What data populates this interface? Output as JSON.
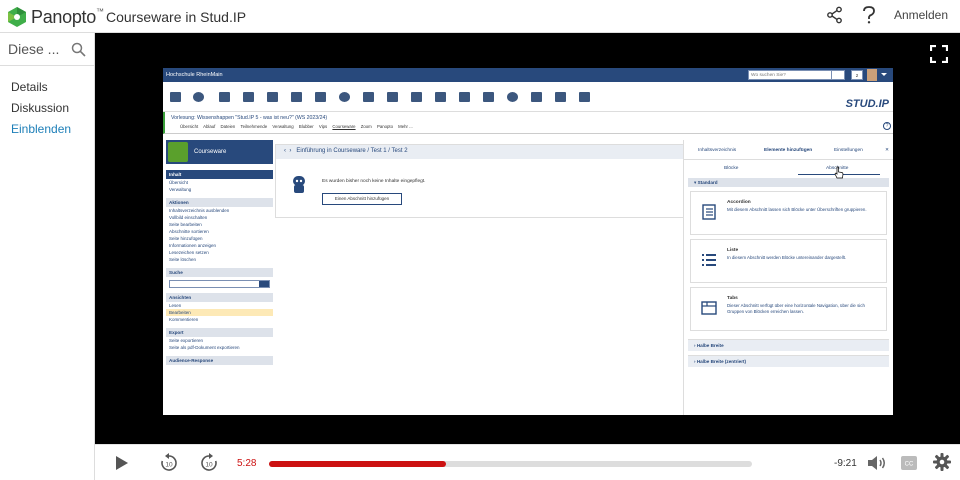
{
  "header": {
    "brand": "Panopto",
    "title": "Courseware in Stud.IP",
    "login": "Anmelden"
  },
  "sidebar": {
    "search_label": "Diese ...",
    "items": [
      {
        "label": "Details"
      },
      {
        "label": "Diskussion"
      },
      {
        "label": "Einblenden"
      }
    ]
  },
  "controls": {
    "elapsed": "5:28",
    "remaining": "-9:21",
    "progress_fraction": 0.367,
    "progress_color": "#cc1111"
  },
  "screen": {
    "org": "Hochschule RheinMain",
    "search_placeholder": "Wo suchen Sie?",
    "count": "2",
    "vlabel": "Veranstaltungen",
    "logo": "STUD.IP",
    "course_title": "Vorlesung: Wissenshappen \"Stud.IP 5 - was ist neu?\" (WS 2023/24)",
    "tabs": [
      "Übersicht",
      "Ablauf",
      "Dateien",
      "Teilnehmende",
      "Verwaltung",
      "Blubber",
      "Vips",
      "Courseware",
      "Zoom",
      "Panopto",
      "Mehr ..."
    ],
    "courseware_label": "Courseware",
    "left": {
      "inhalt": "Inhalt",
      "inhalt_links": [
        "Übersicht",
        "Verwaltung"
      ],
      "aktionen": "Aktionen",
      "aktionen_links": [
        "Inhaltsverzeichnis ausblenden",
        "Vollbild einschalten",
        "Seite bearbeiten",
        "Abschnitte sortieren",
        "Seite hinzufügen",
        "Informationen anzeigen",
        "Lesezeichen setzen",
        "Seite löschen"
      ],
      "suche": "Suche",
      "ansichten": "Ansichten",
      "ansichten_links": [
        "Lesen",
        "Bearbeiten",
        "Kommentieren"
      ],
      "export": "Export",
      "export_links": [
        "Seite exportieren",
        "Seite als pdf-Dokument exportieren"
      ],
      "audience": "Audience-Response"
    },
    "breadcrumb": "Einführung in Courseware / Test 1 / Test 2",
    "empty_info": "Es wurden bisher noch keine Inhalte eingepflegt.",
    "add_section_btn": "Einen Abschnitt hinzufügen",
    "right": {
      "tabs": [
        "Inhaltsverzeichnis",
        "Elemente hinzufügen",
        "Einstellungen"
      ],
      "subtabs": [
        "Blöcke",
        "Abschnitte"
      ],
      "section": "Standard",
      "cards": [
        {
          "title": "Accordion",
          "desc": "Mit diesem Abschnitt lassen sich Blöcke unter Überschriften gruppieren."
        },
        {
          "title": "Liste",
          "desc": "In diesem Abschnitt werden Blöcke untereinander dargestellt."
        },
        {
          "title": "Tabs",
          "desc": "Dieser Abschnitt verfügt über eine horizontale Navigation, über die sich Gruppen von Blöcken erreichen lassen."
        }
      ],
      "acc1": "Halbe Breite",
      "acc2": "Halbe Breite (zentriert)"
    }
  }
}
